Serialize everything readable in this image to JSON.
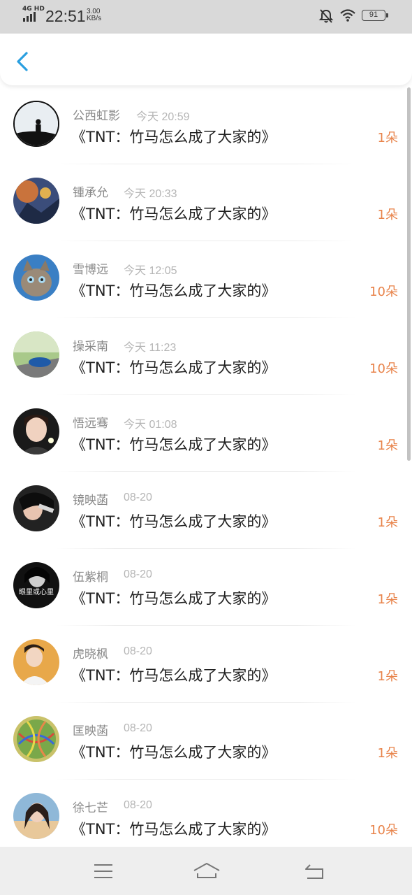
{
  "status_bar": {
    "network": "4G HD",
    "time": "22:51",
    "speed_value": "3.00",
    "speed_unit": "KB/s",
    "battery": "91"
  },
  "header": {
    "back_icon": "chevron-left-icon",
    "accent": "#2a9fe0"
  },
  "list": {
    "count_color": "#e8834a",
    "items": [
      {
        "name": "公西虹影",
        "time": "今天 20:59",
        "title": "《TNT：竹马怎么成了大家的》",
        "count": "1朵"
      },
      {
        "name": "锺承允",
        "time": "今天 20:33",
        "title": "《TNT：竹马怎么成了大家的》",
        "count": "1朵"
      },
      {
        "name": "雪博远",
        "time": "今天 12:05",
        "title": "《TNT：竹马怎么成了大家的》",
        "count": "10朵"
      },
      {
        "name": "操采南",
        "time": "今天 11:23",
        "title": "《TNT：竹马怎么成了大家的》",
        "count": "10朵"
      },
      {
        "name": "悟远骞",
        "time": "今天 01:08",
        "title": "《TNT：竹马怎么成了大家的》",
        "count": "1朵"
      },
      {
        "name": "镜映菡",
        "time": "08-20",
        "title": "《TNT：竹马怎么成了大家的》",
        "count": "1朵"
      },
      {
        "name": "伍紫桐",
        "time": "08-20",
        "title": "《TNT：竹马怎么成了大家的》",
        "count": "1朵",
        "avatar_text": "眼里或心里"
      },
      {
        "name": "虎晓枫",
        "time": "08-20",
        "title": "《TNT：竹马怎么成了大家的》",
        "count": "1朵"
      },
      {
        "name": "匡映菡",
        "time": "08-20",
        "title": "《TNT：竹马怎么成了大家的》",
        "count": "1朵"
      },
      {
        "name": "徐七芒",
        "time": "08-20",
        "title": "《TNT：竹马怎么成了大家的》",
        "count": "10朵"
      }
    ]
  },
  "nav_bar": {
    "icons": [
      "menu-icon",
      "home-icon",
      "back-icon"
    ]
  }
}
